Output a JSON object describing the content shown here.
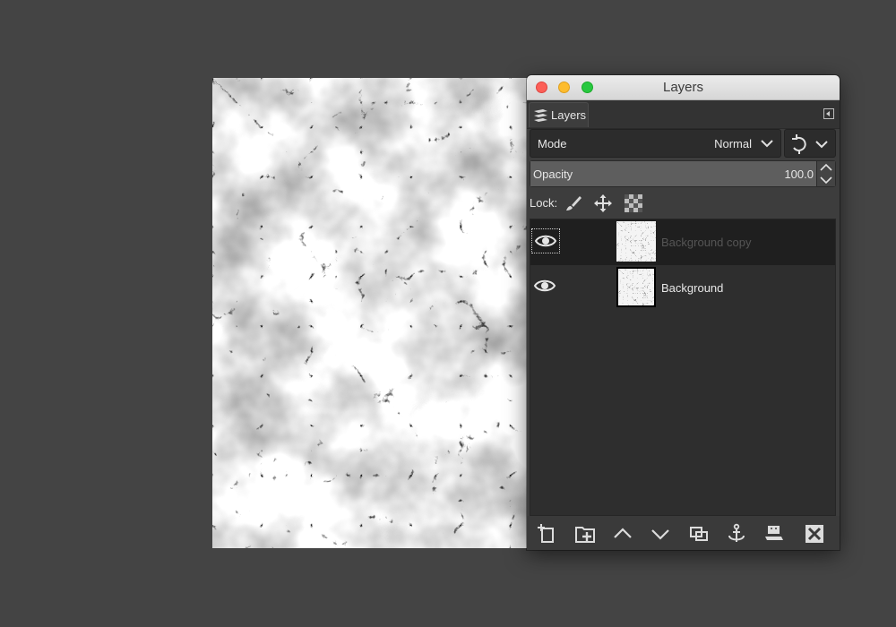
{
  "window": {
    "title": "Layers",
    "traffic_lights": {
      "close": "#fc5f57",
      "minimize": "#fdbc2e",
      "zoom": "#28c840"
    }
  },
  "dock": {
    "tab_label": "Layers",
    "tab_icon": "layers-stack-icon",
    "menu_icon": "tab-menu-icon"
  },
  "mode": {
    "label": "Mode",
    "value": "Normal"
  },
  "opacity": {
    "label": "Opacity",
    "value": "100.0",
    "fraction": 1.0
  },
  "lock": {
    "label": "Lock:",
    "icons": [
      "paintbrush-icon",
      "move-arrows-icon",
      "alpha-checker-icon"
    ]
  },
  "layers": [
    {
      "name": "Background copy",
      "visible": true,
      "selected": true
    },
    {
      "name": "Background",
      "visible": true,
      "selected": false
    }
  ],
  "bottom_toolbar": [
    "new-layer-icon",
    "new-layer-group-icon",
    "raise-layer-icon",
    "lower-layer-icon",
    "duplicate-layer-icon",
    "anchor-layer-icon",
    "merge-down-icon",
    "delete-layer-icon"
  ],
  "colors": {
    "background": "#444444",
    "panel": "#3d3d3d",
    "selected_row": "#1f1f1f"
  }
}
